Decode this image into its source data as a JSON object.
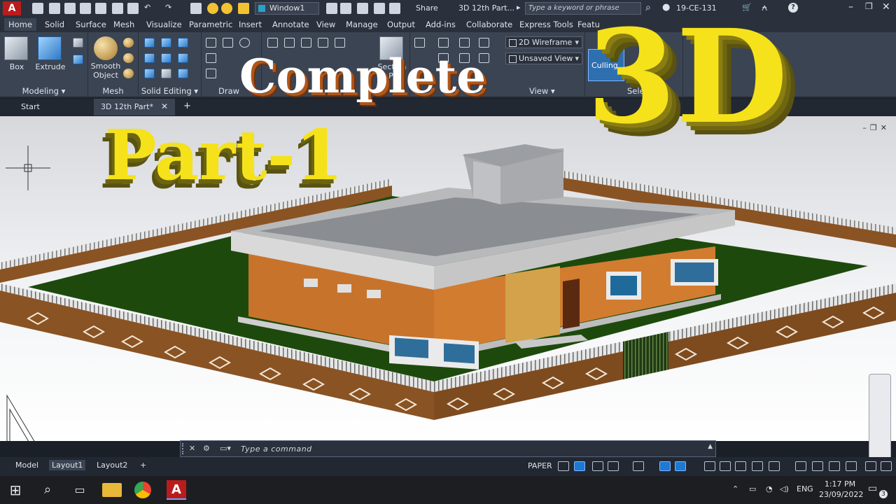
{
  "app": {
    "window_title": "3D 12th Part...",
    "workspace": "Window1",
    "share_label": "Share",
    "search_placeholder": "Type a keyword or phrase",
    "user": "19-CE-131"
  },
  "menu_tabs": [
    "Home",
    "Solid",
    "Surface",
    "Mesh",
    "Visualize",
    "Parametric",
    "Insert",
    "Annotate",
    "View",
    "Manage",
    "Output",
    "Add-ins",
    "Collaborate",
    "Express Tools",
    "Featu"
  ],
  "ribbon": {
    "modeling": {
      "footer": "Modeling ▾",
      "box": "Box",
      "extrude": "Extrude"
    },
    "mesh": {
      "footer": "Mesh",
      "smooth": "Smooth Object"
    },
    "solid_editing": {
      "footer": "Solid Editing ▾"
    },
    "draw": {
      "footer": "Draw"
    },
    "section": {
      "label": "Section Pl"
    },
    "view": {
      "visual_style": "2D Wireframe",
      "named_view": "Unsaved View",
      "footer": "View ▾"
    },
    "selection": {
      "culling": "Culling",
      "footer": "Sele"
    }
  },
  "file_tabs": {
    "start": "Start",
    "drawing": "3D 12th Part*"
  },
  "overlay": {
    "complete": "Complete",
    "three_d": "3D",
    "part": "Part-1"
  },
  "command": {
    "placeholder": "Type a command"
  },
  "status": {
    "layouts": [
      "Model",
      "Layout1",
      "Layout2"
    ],
    "paper": "PAPER"
  },
  "taskbar": {
    "lang": "ENG",
    "time": "1:17 PM",
    "date": "23/09/2022",
    "notifications": "3"
  },
  "colors": {
    "wall": "#c8732c",
    "lawn": "#1d4a0c",
    "roof": "#8a8d92",
    "parapet": "#b8b9bb",
    "fence_wall": "#8a5323",
    "ribbon_bg": "#3b4453",
    "title_yellow": "#f5e21a"
  }
}
